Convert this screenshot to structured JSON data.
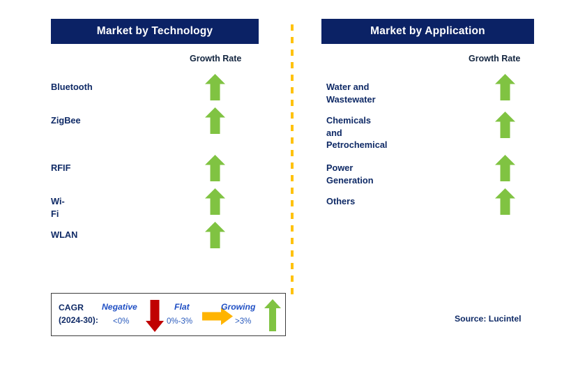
{
  "colors": {
    "header_bg": "#0b2265",
    "header_text": "#ffffff",
    "label_text": "#0f2a66",
    "arrow_green": "#80c342",
    "arrow_red": "#c00000",
    "arrow_orange": "#ffb400",
    "divider_dash": "#ffc20e",
    "legend_border": "#3c3c3c",
    "page_bg": "#ffffff"
  },
  "panels": [
    {
      "id": "technology",
      "header_title": "Market by Technology",
      "growth_caption": "Growth Rate",
      "rows": [
        {
          "label": "Bluetooth",
          "growth_icon": "arrow-up-green",
          "growth": "Growing"
        },
        {
          "label": "ZigBee",
          "growth_icon": "arrow-up-green",
          "growth": "Growing"
        },
        {
          "label": "RFIF",
          "growth_icon": "arrow-up-green",
          "growth": "Growing"
        },
        {
          "label": "Wi-Fi",
          "growth_icon": "arrow-up-green",
          "growth": "Growing"
        },
        {
          "label": "WLAN",
          "growth_icon": "arrow-up-green",
          "growth": "Growing"
        }
      ]
    },
    {
      "id": "application",
      "header_title": "Market by Application",
      "growth_caption": "Growth Rate",
      "rows": [
        {
          "label": "Water and Wastewater",
          "growth_icon": "arrow-up-green",
          "growth": "Growing"
        },
        {
          "label": "Chemicals and\nPetrochemical",
          "growth_icon": "arrow-up-green",
          "growth": "Growing"
        },
        {
          "label": "Power Generation",
          "growth_icon": "arrow-up-green",
          "growth": "Growing"
        },
        {
          "label": "Others",
          "growth_icon": "arrow-up-green",
          "growth": "Growing"
        }
      ]
    }
  ],
  "legend": {
    "title": "CAGR\n(2024-30):",
    "entries": [
      {
        "term": "Negative",
        "range": "<0%",
        "icon": "arrow-down-red"
      },
      {
        "term": "Flat",
        "range": "0%-3%",
        "icon": "arrow-right-orange"
      },
      {
        "term": "Growing",
        "range": ">3%",
        "icon": "arrow-up-green"
      }
    ]
  },
  "source": "Source: Lucintel"
}
